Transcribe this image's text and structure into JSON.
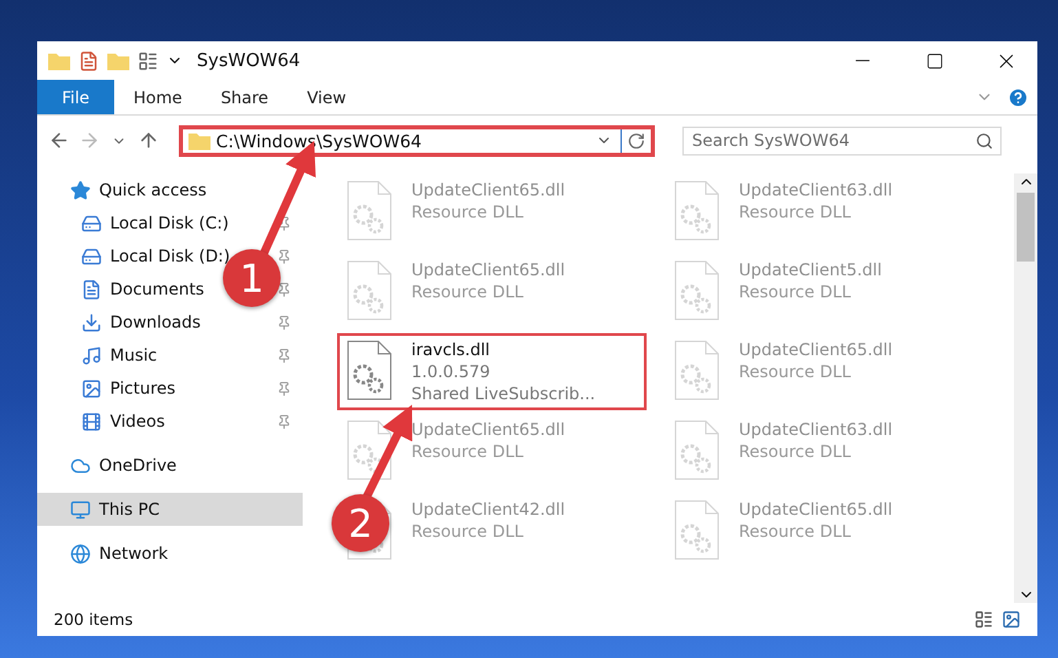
{
  "window": {
    "title": "SysWOW64"
  },
  "ribbon": [
    {
      "label": "File",
      "kind": "menu"
    },
    {
      "label": "Home",
      "kind": "tab"
    },
    {
      "label": "Share",
      "kind": "tab"
    },
    {
      "label": "View",
      "kind": "tab"
    }
  ],
  "address": {
    "path": "C:\\Windows\\SysWOW64",
    "highlighted": true
  },
  "search": {
    "placeholder": "Search SysWOW64"
  },
  "sidebar": [
    {
      "label": "Quick access",
      "selected": false,
      "children": [
        {
          "label": "Local Disk (C:)",
          "pinned": true
        },
        {
          "label": "Local Disk (D:)",
          "pinned": true
        },
        {
          "label": "Documents",
          "pinned": true
        },
        {
          "label": "Downloads",
          "pinned": true
        },
        {
          "label": "Music",
          "pinned": true
        },
        {
          "label": "Pictures",
          "pinned": true
        },
        {
          "label": "Videos",
          "pinned": true
        }
      ]
    },
    {
      "label": "OneDrive",
      "selected": false
    },
    {
      "label": "This PC",
      "selected": true
    },
    {
      "label": "Network",
      "selected": false
    }
  ],
  "files": [
    {
      "name": "UpdateClient65.dll",
      "details": [
        "Resource DLL"
      ],
      "dimmed": true,
      "highlighted": false
    },
    {
      "name": "UpdateClient63.dll",
      "details": [
        "Resource DLL"
      ],
      "dimmed": true,
      "highlighted": false
    },
    {
      "name": "UpdateClient65.dll",
      "details": [
        "Resource DLL"
      ],
      "dimmed": true,
      "highlighted": false
    },
    {
      "name": "UpdateClient5.dll",
      "details": [
        "Resource DLL"
      ],
      "dimmed": true,
      "highlighted": false
    },
    {
      "name": "iravcls.dll",
      "details": [
        "1.0.0.579",
        "Shared LiveSubscrib..."
      ],
      "dimmed": false,
      "highlighted": true
    },
    {
      "name": "UpdateClient65.dll",
      "details": [
        "Resource DLL"
      ],
      "dimmed": true,
      "highlighted": false
    },
    {
      "name": "UpdateClient65.dll",
      "details": [
        "Resource DLL"
      ],
      "dimmed": true,
      "highlighted": false
    },
    {
      "name": "UpdateClient63.dll",
      "details": [
        "Resource DLL"
      ],
      "dimmed": true,
      "highlighted": false
    },
    {
      "name": "UpdateClient42.dll",
      "details": [
        "Resource DLL"
      ],
      "dimmed": true,
      "highlighted": false
    },
    {
      "name": "UpdateClient65.dll",
      "details": [
        "Resource DLL"
      ],
      "dimmed": true,
      "highlighted": false
    }
  ],
  "status_bar": {
    "count": "200 items"
  },
  "annotations": [
    {
      "label": "1"
    },
    {
      "label": "2"
    }
  ]
}
